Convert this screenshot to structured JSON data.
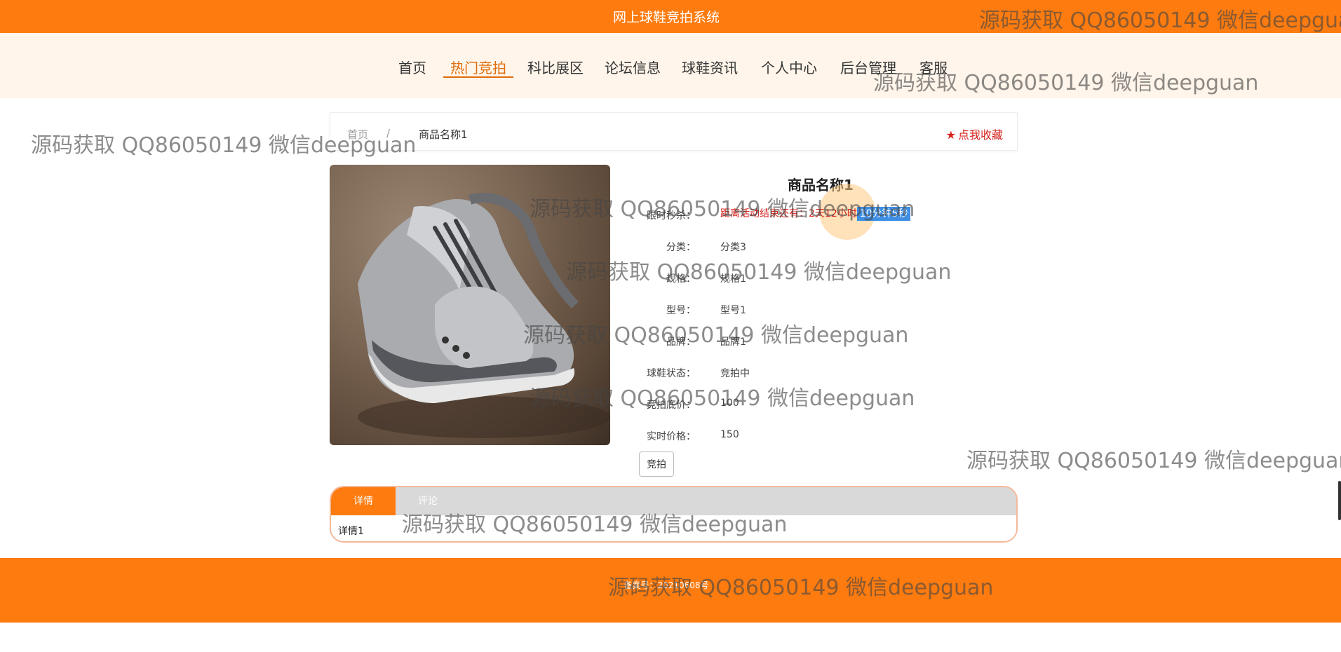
{
  "header": {
    "site_title": "网上球鞋竞拍系统"
  },
  "nav": [
    {
      "label": "首页"
    },
    {
      "label": "热门竞拍"
    },
    {
      "label": "科比展区"
    },
    {
      "label": "论坛信息"
    },
    {
      "label": "球鞋资讯"
    },
    {
      "label": "个人中心"
    },
    {
      "label": "后台管理"
    },
    {
      "label": "客服"
    }
  ],
  "breadcrumb": {
    "home": "首页",
    "separator": "/",
    "current": "商品名称1"
  },
  "favorite": {
    "label": "点我收藏",
    "icon": "star-icon"
  },
  "product": {
    "title": "商品名称1",
    "image_alt": "silver basketball shoe photo",
    "fields": [
      {
        "label": "限时秒杀：",
        "value": ""
      },
      {
        "label": "分类：",
        "value": "分类3"
      },
      {
        "label": "规格：",
        "value": "规格1"
      },
      {
        "label": "型号：",
        "value": "型号1"
      },
      {
        "label": "品牌：",
        "value": "品牌1"
      },
      {
        "label": "球鞋状态：",
        "value": "竞拍中"
      },
      {
        "label": "竞拍底价：",
        "value": "100"
      },
      {
        "label": "实时价格：",
        "value": "150"
      }
    ],
    "countdown": {
      "prefix": "距离活动结束还有：2天12小时",
      "highlight": "10分钟5秒"
    }
  },
  "actions": {
    "bid_label": "竞拍"
  },
  "tabs": [
    {
      "label": "详情"
    },
    {
      "label": "评论"
    }
  ],
  "tab_content": "详情1",
  "footer": {
    "text": "备案号：20210608号"
  },
  "watermark": "源码获取 QQ86050149 微信deepguan",
  "colors": {
    "primary": "#fd7b0f",
    "nav_bg": "#fff5ea",
    "accent_red": "#d7221c"
  }
}
